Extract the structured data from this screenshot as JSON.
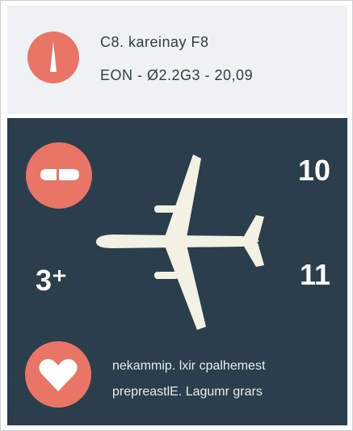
{
  "colors": {
    "accent": "#e97567",
    "panel": "#2a3e4b",
    "header_bg": "#eef2f3",
    "text_dark": "#2f3e49",
    "text_light": "#ffffff"
  },
  "header": {
    "icon": "compass-needle-icon",
    "title": "C8. kareinay F8",
    "subtitle": "EON - Ø2.2G3 - 20,09"
  },
  "panel": {
    "top_icon": "pill-icon",
    "plane_icon": "airplane-icon",
    "numbers": {
      "top_right": "10",
      "left": "3⁺",
      "right": "11"
    },
    "bottom_icon": "heart-icon",
    "footer_line1": "nekammip. lxir  cpalhemest",
    "footer_line2": "prepreastlE. Lagumr grars"
  }
}
